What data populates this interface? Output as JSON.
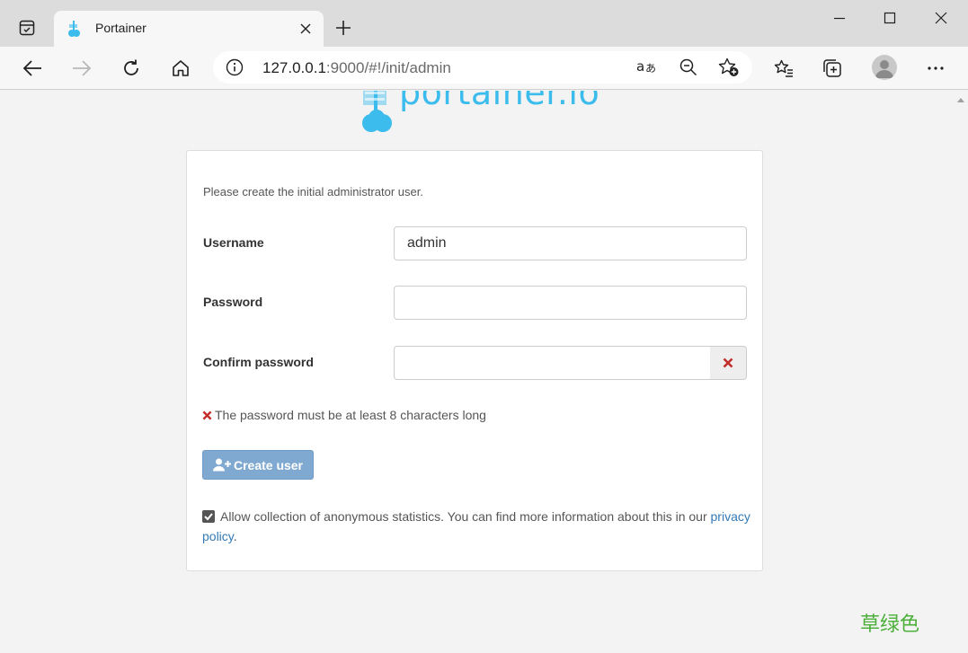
{
  "browser": {
    "tab": {
      "title": "Portainer"
    },
    "address": {
      "host": "127.0.0.1",
      "rest": ":9000/#!/init/admin"
    }
  },
  "page": {
    "logo_text": "portainer.io",
    "intro": "Please create the initial administrator user.",
    "form": {
      "username_label": "Username",
      "username_value": "admin",
      "password_label": "Password",
      "confirm_label": "Confirm password"
    },
    "error_message": "The password must be at least 8 characters long",
    "create_button_label": "Create user",
    "stats": {
      "checked": true,
      "text": "Allow collection of anonymous statistics. You can find more information about this in our ",
      "link": "privacy policy",
      "suffix": "."
    }
  },
  "watermark": "草绿色",
  "colors": {
    "accent": "#3bbced",
    "button": "#7fa9d0",
    "error": "#c12e2a",
    "link": "#337ab7",
    "watermark": "#4caf3a"
  }
}
